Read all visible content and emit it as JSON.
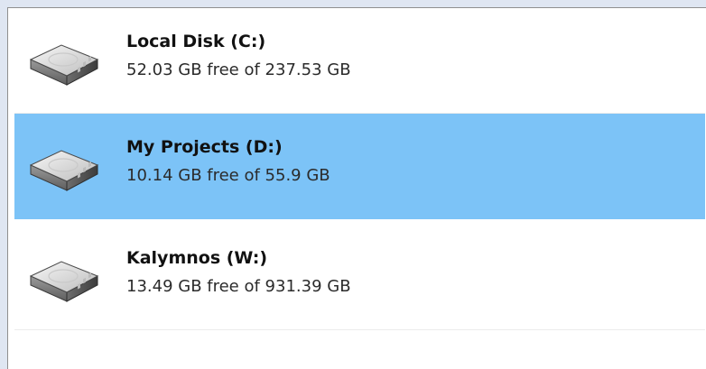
{
  "drives": [
    {
      "name": "Local Disk (C:)",
      "space": "52.03 GB free of 237.53 GB",
      "icon": "hard-drive-icon",
      "selected": false
    },
    {
      "name": "My Projects (D:)",
      "space": "10.14 GB free of 55.9 GB",
      "icon": "hard-drive-icon",
      "selected": true
    },
    {
      "name": "Kalymnos (W:)",
      "space": "13.49 GB free of 931.39 GB",
      "icon": "hard-drive-icon",
      "selected": false
    }
  ],
  "colors": {
    "selection": "#7cc3f7",
    "background": "#ffffff",
    "window_backdrop": "#dfe6f2"
  }
}
